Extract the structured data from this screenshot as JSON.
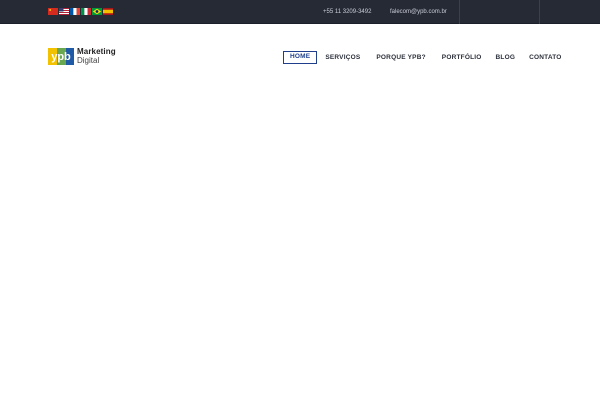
{
  "topbar": {
    "flags": [
      {
        "name": "china-flag-icon",
        "colors": [
          "#d52b1e",
          "#ffde00"
        ]
      },
      {
        "name": "usa-flag-icon",
        "colors": [
          "#b22234",
          "#ffffff",
          "#3c3b6e"
        ]
      },
      {
        "name": "france-flag-icon",
        "colors": [
          "#0055a4",
          "#ffffff",
          "#ef4135"
        ]
      },
      {
        "name": "italy-flag-icon",
        "colors": [
          "#009246",
          "#ffffff",
          "#ce2b37"
        ]
      },
      {
        "name": "brazil-flag-icon",
        "colors": [
          "#009c3b",
          "#ffdf00",
          "#002776"
        ]
      },
      {
        "name": "spain-flag-icon",
        "colors": [
          "#aa151b",
          "#f1bf00"
        ]
      }
    ],
    "phone": "+55 11 3209-3492",
    "email": "falecom@ypb.com.br"
  },
  "logo": {
    "mark": "ypb",
    "line1": "Marketing",
    "line2": "Digital",
    "colors": {
      "blue": "#1f5aa6",
      "yellow": "#f2c200",
      "green": "#6aa84f"
    }
  },
  "nav": {
    "items": [
      {
        "label": "HOME",
        "active": true
      },
      {
        "label": "SERVIÇOS",
        "active": false
      },
      {
        "label": "PORQUE YPB?",
        "active": false
      },
      {
        "label": "PORTFÓLIO",
        "active": false
      },
      {
        "label": "BLOG",
        "active": false
      },
      {
        "label": "CONTATO",
        "active": false
      }
    ],
    "active_color": "#1f3f8c"
  }
}
